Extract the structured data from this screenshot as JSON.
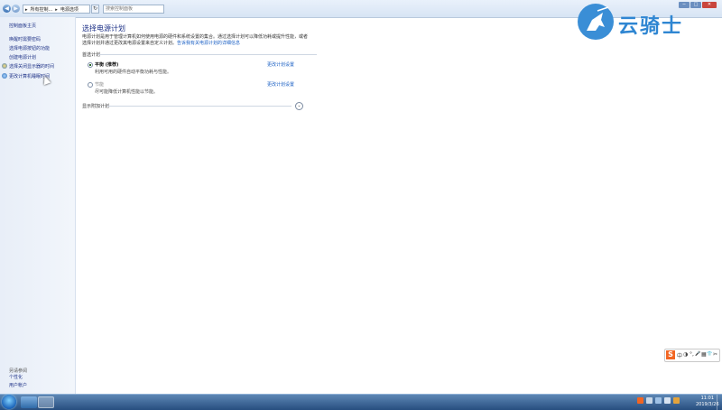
{
  "address_bar": {
    "back_label": "◀",
    "forward_label": "▶",
    "breadcrumbs": [
      "▸",
      "所有控制...",
      "▸",
      "电源选项"
    ],
    "refresh_label": "↻",
    "search_placeholder": "搜索控制面板",
    "window_buttons": [
      "─",
      "□",
      "✕"
    ]
  },
  "left_pane": {
    "home_link": "控制面板主页",
    "links": [
      "唤醒时需要密码",
      "选择电源按钮的功能",
      "创建电源计划",
      "选择关闭显示器的时间",
      "更改计算机睡眠时间"
    ],
    "see_also_title": "另请参阅",
    "see_also_links": [
      "个性化",
      "用户帐户"
    ]
  },
  "main": {
    "title": "选择电源计划",
    "intro_text": "电源计划是用于管理计算机如何使用电源的硬件和系统设置的集合。通过选择计划可以降低功耗或提升性能，或者选择计划并通过更改其电源设置来自定义计划。",
    "intro_link": "告诉我有关电源计划的详细信息",
    "preferred_section": "首选计划",
    "plans": [
      {
        "name": "平衡 (推荐)",
        "desc": "利用可用的硬件自动平衡功耗与性能。",
        "link": "更改计划设置",
        "selected": true
      },
      {
        "name": "节能",
        "desc": "尽可能降低计算机性能以节能。",
        "link": "更改计划设置",
        "selected": false
      }
    ],
    "show_more": "显示附加计划",
    "show_more_chevron": "⌄"
  },
  "watermark": {
    "text": "云骑士"
  },
  "ime_toolbar": {
    "logo": "S",
    "items": [
      "中",
      "◑",
      "°,",
      "🎤",
      "▦",
      "👕",
      "✂"
    ]
  },
  "taskbar": {
    "time": "11:01",
    "date": "2019/3/26"
  }
}
